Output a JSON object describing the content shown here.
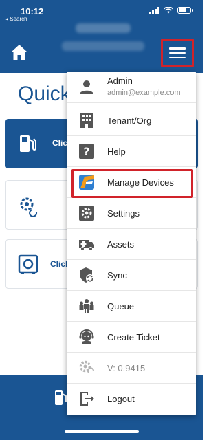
{
  "status_bar": {
    "time": "10:12",
    "back_label": "◂ Search"
  },
  "colors": {
    "brand": "#1a5593",
    "highlight": "#d1232a"
  },
  "header": {
    "home_icon": "home-icon",
    "menu_icon": "hamburger-menu-icon"
  },
  "page": {
    "title": "Quick",
    "cards": [
      {
        "label": "Clic",
        "icon": "fuel-pump-icon"
      },
      {
        "label": "",
        "icon": "gear-sync-icon"
      },
      {
        "label": "Click",
        "icon": "safe-icon"
      }
    ]
  },
  "menu": {
    "user": {
      "name": "Admin",
      "email": "admin@example.com"
    },
    "items": [
      {
        "label": "Tenant/Org",
        "icon": "building-icon"
      },
      {
        "label": "Help",
        "icon": "help-icon"
      },
      {
        "label": "Manage Devices",
        "icon": "manage-devices-icon"
      },
      {
        "label": "Settings",
        "icon": "settings-icon"
      },
      {
        "label": "Assets",
        "icon": "ambulance-icon"
      },
      {
        "label": "Sync",
        "icon": "shield-sync-icon"
      },
      {
        "label": "Queue",
        "icon": "people-icon"
      },
      {
        "label": "Create Ticket",
        "icon": "support-agent-icon"
      },
      {
        "label": "V: 0.9415",
        "icon": "version-gear-icon"
      },
      {
        "label": "Logout",
        "icon": "logout-icon"
      }
    ]
  }
}
